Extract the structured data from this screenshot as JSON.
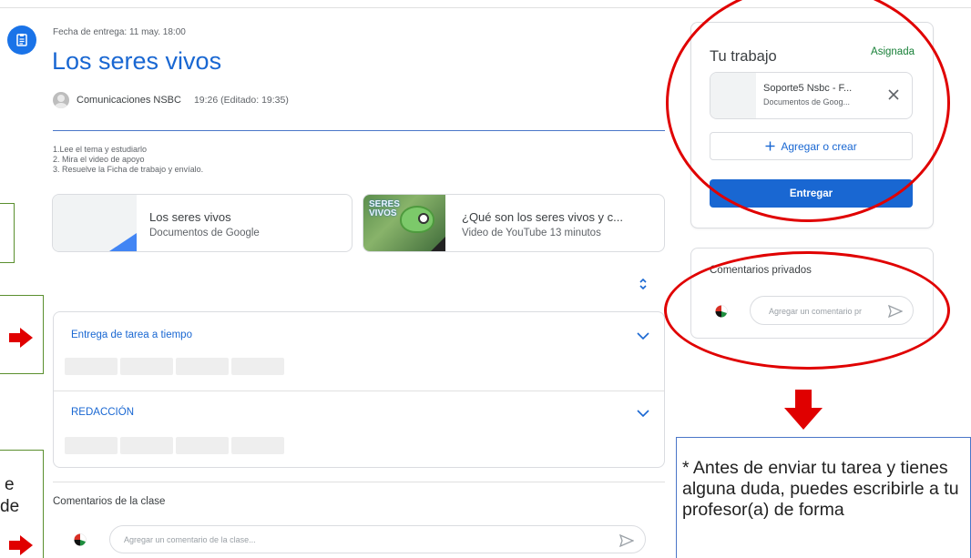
{
  "assignment": {
    "due": "Fecha de entrega: 11 may. 18:00",
    "title": "Los seres vivos",
    "author": "Comunicaciones NSBC",
    "posted": "19:26 (Editado: 19:35)",
    "instructions": [
      "1.Lee el tema y estudiarlo",
      "2. Mira el video de apoyo",
      "3. Resuelve la Ficha de trabajo y envíalo."
    ]
  },
  "attachments": [
    {
      "title": "Los seres vivos",
      "subtitle": "Documentos de Google"
    },
    {
      "title": "¿Qué son los seres vivos y c...",
      "subtitle": "Video de YouTube  13 minutos",
      "thumb_text": "SERES VIVOS"
    }
  ],
  "rubric": {
    "criteria": [
      {
        "title": "Entrega de tarea a tiempo"
      },
      {
        "title": "REDACCIÓN"
      }
    ]
  },
  "class_comments": {
    "label": "Comentarios de la clase",
    "placeholder": "Agregar un comentario de la clase..."
  },
  "your_work": {
    "title": "Tu trabajo",
    "status": "Asignada",
    "file_name": "Soporte5 Nsbc - F...",
    "file_type": "Documentos de Goog...",
    "add_label": "Agregar o crear",
    "submit_label": "Entregar"
  },
  "private_comments": {
    "title": "Comentarios privados",
    "placeholder": "Agregar un comentario pr"
  },
  "annotations": {
    "note": "* Antes de enviar tu tarea y tienes alguna duda, puedes escribirle a tu profesor(a) de forma",
    "edge_text_1": "e",
    "edge_text_2": "de",
    "ellipse_color": "#e00000"
  },
  "colors": {
    "accent": "#1967d2",
    "status_green": "#188038",
    "annotation_red": "#e00000"
  }
}
